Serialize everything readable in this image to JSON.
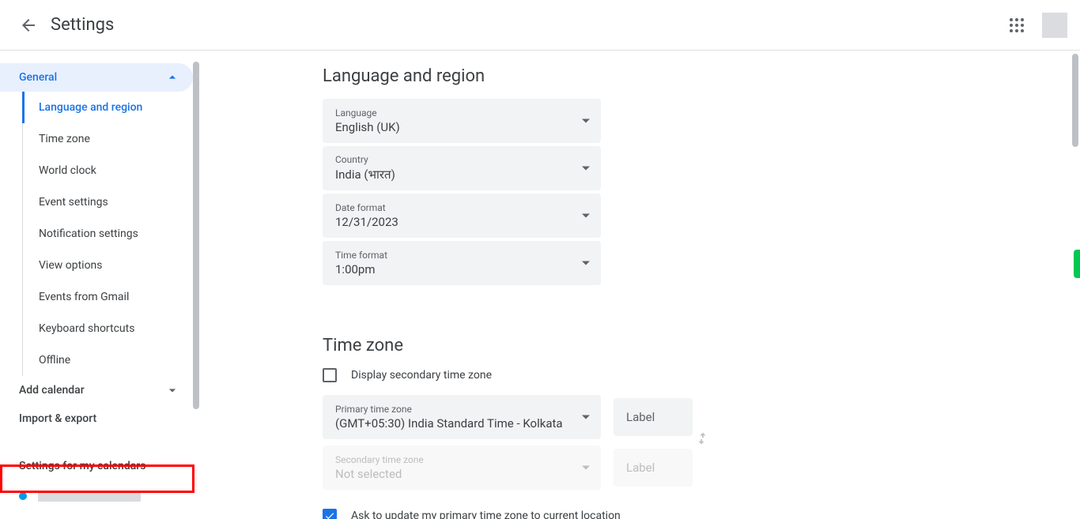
{
  "header": {
    "title": "Settings"
  },
  "sidebar": {
    "general_label": "General",
    "general_items": {
      "language_region": "Language and region",
      "time_zone": "Time zone",
      "world_clock": "World clock",
      "event_settings": "Event settings",
      "notification_settings": "Notification settings",
      "view_options": "View options",
      "events_from_gmail": "Events from Gmail",
      "keyboard_shortcuts": "Keyboard shortcuts",
      "offline": "Offline"
    },
    "add_calendar": "Add calendar",
    "import_export": "Import & export",
    "settings_for_my_calendars": "Settings for my calendars"
  },
  "content": {
    "lang_region": {
      "title": "Language and region",
      "language_label": "Language",
      "language_value": "English (UK)",
      "country_label": "Country",
      "country_value": "India (भारत)",
      "date_format_label": "Date format",
      "date_format_value": "12/31/2023",
      "time_format_label": "Time format",
      "time_format_value": "1:00pm"
    },
    "time_zone": {
      "title": "Time zone",
      "display_secondary_label": "Display secondary time zone",
      "primary_label": "Primary time zone",
      "primary_value": "(GMT+05:30) India Standard Time - Kolkata",
      "secondary_label": "Secondary time zone",
      "secondary_value": "Not selected",
      "label_placeholder": "Label",
      "ask_update_label": "Ask to update my primary time zone to current location"
    }
  }
}
